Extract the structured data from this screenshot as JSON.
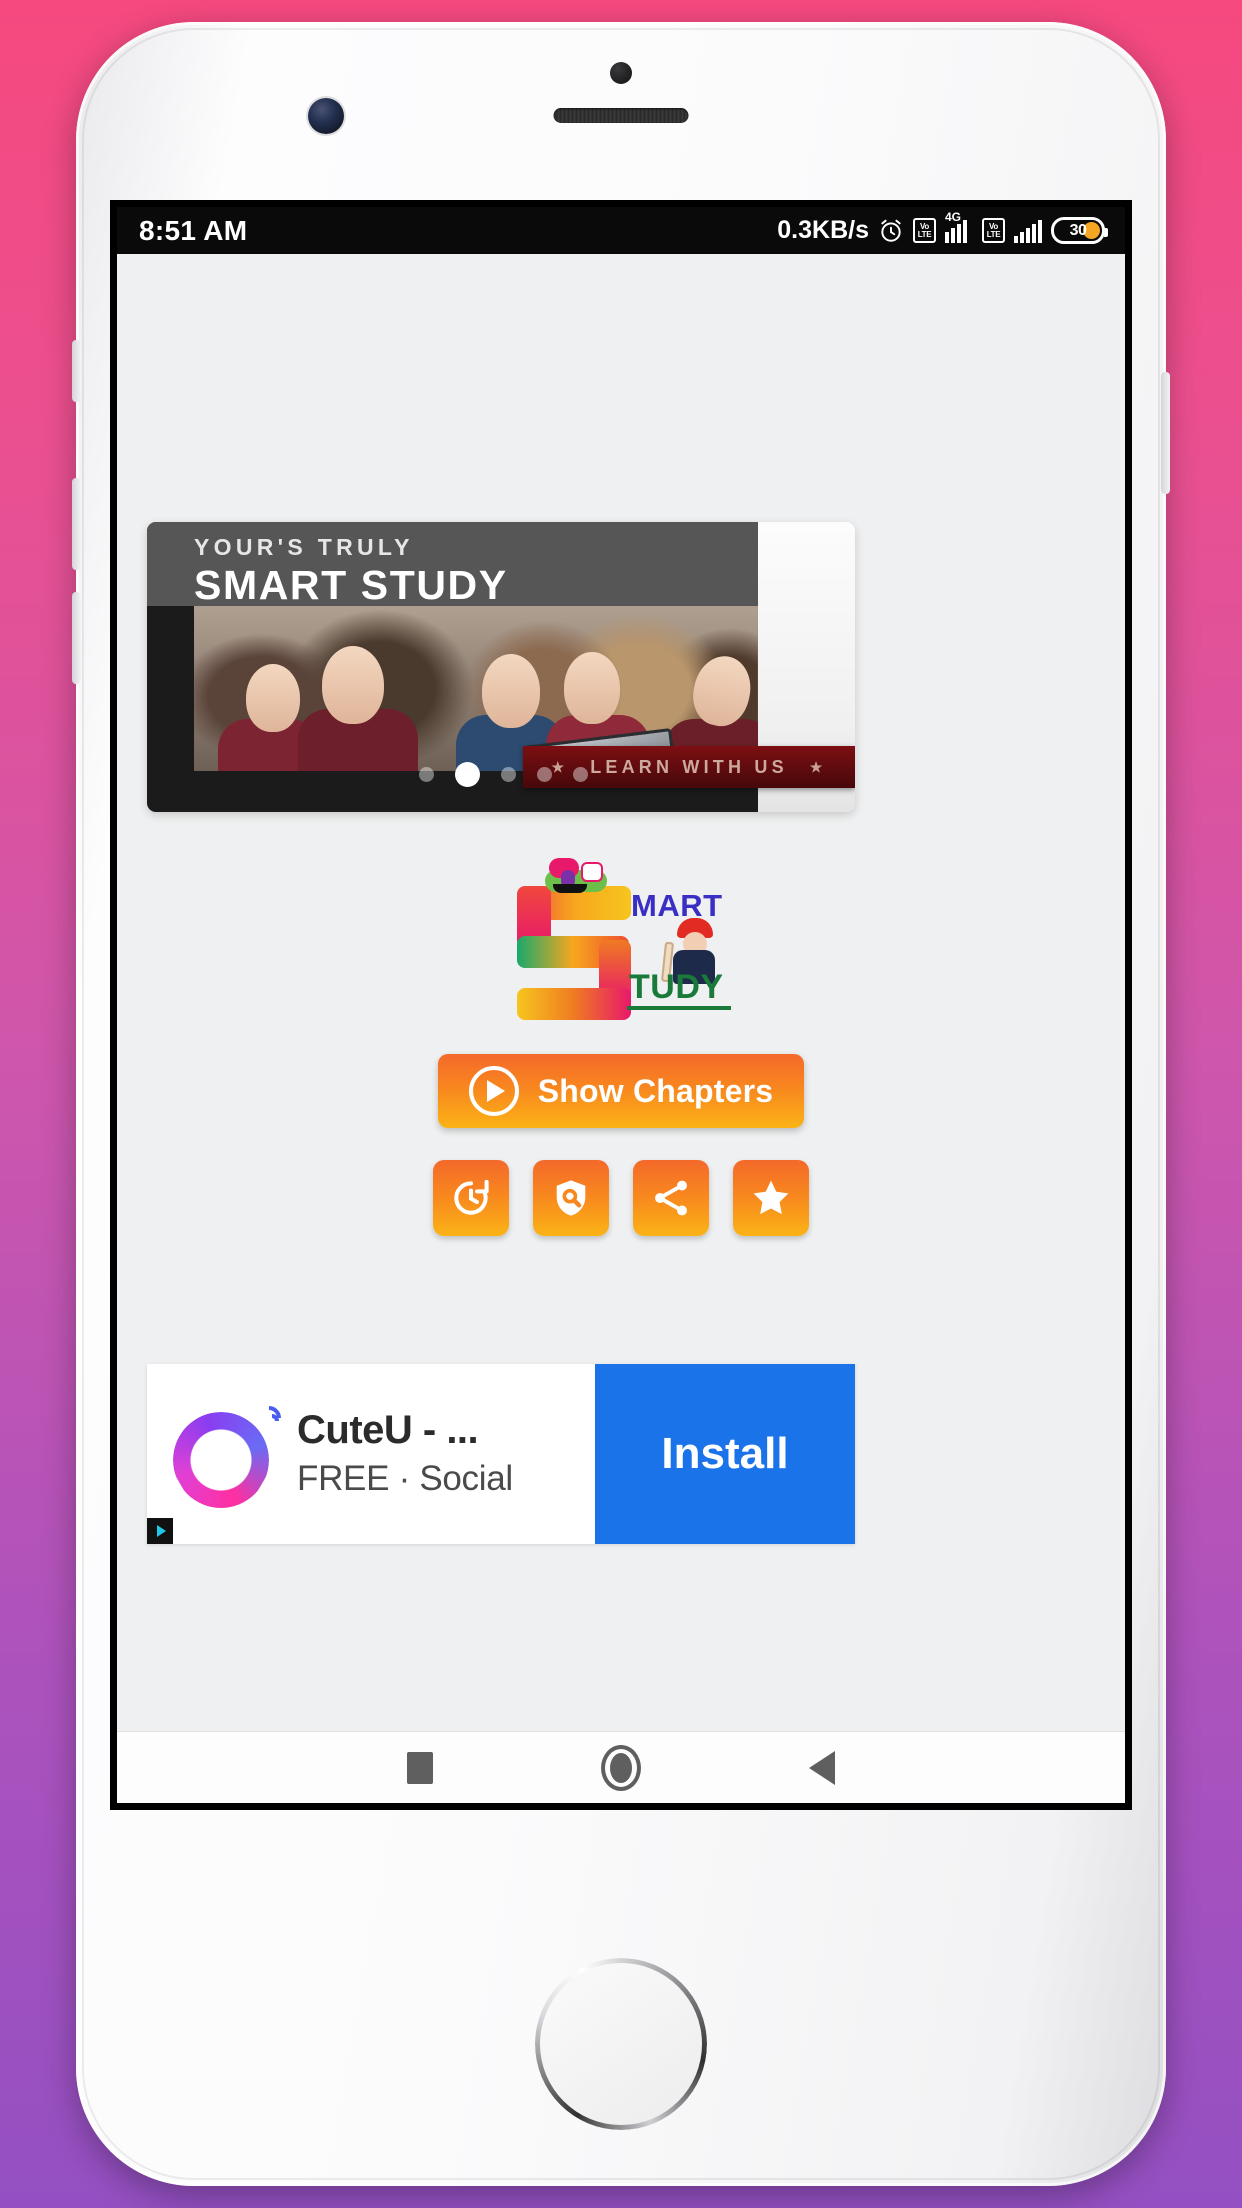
{
  "statusbar": {
    "time": "8:51 AM",
    "network_speed": "0.3KB/s",
    "alarm_icon": "alarm-clock-icon",
    "volte_top": "Vo",
    "volte_bottom": "LTE",
    "network_type": "4G",
    "battery_level": "30"
  },
  "carousel": {
    "slide_subtitle": "YOUR'S TRULY",
    "slide_title": "SMART STUDY",
    "learn_banner": "LEARN WITH US",
    "star_left": "★",
    "star_right": "★",
    "dot_count": 5,
    "active_dot_index": 1
  },
  "logo": {
    "mart": "MART",
    "tudy": "TUDY"
  },
  "main": {
    "show_chapters_label": "Show Chapters",
    "play_icon": "play-circle-icon",
    "actions": [
      {
        "name": "update-button",
        "icon": "history-refresh-icon"
      },
      {
        "name": "privacy-policy-button",
        "icon": "shield-search-icon"
      },
      {
        "name": "share-button",
        "icon": "share-icon"
      },
      {
        "name": "rate-us-button",
        "icon": "star-icon"
      }
    ]
  },
  "ad": {
    "title": "CuteU - ...",
    "subtitle": "FREE · Social",
    "install_label": "Install",
    "app_icon": "cuteu-logo-icon",
    "ad_choices_icon": "ad-choices-icon"
  },
  "navbar": {
    "recents": "recents-square-icon",
    "home": "home-circle-icon",
    "back": "back-triangle-icon"
  },
  "colors": {
    "accent_orange": "#f8881e",
    "install_blue": "#1a73e8",
    "banner_red": "#5e0b0e",
    "battery_orange": "#f5a623",
    "bg_pink": "#f5497f",
    "bg_purple": "#9450c2"
  }
}
